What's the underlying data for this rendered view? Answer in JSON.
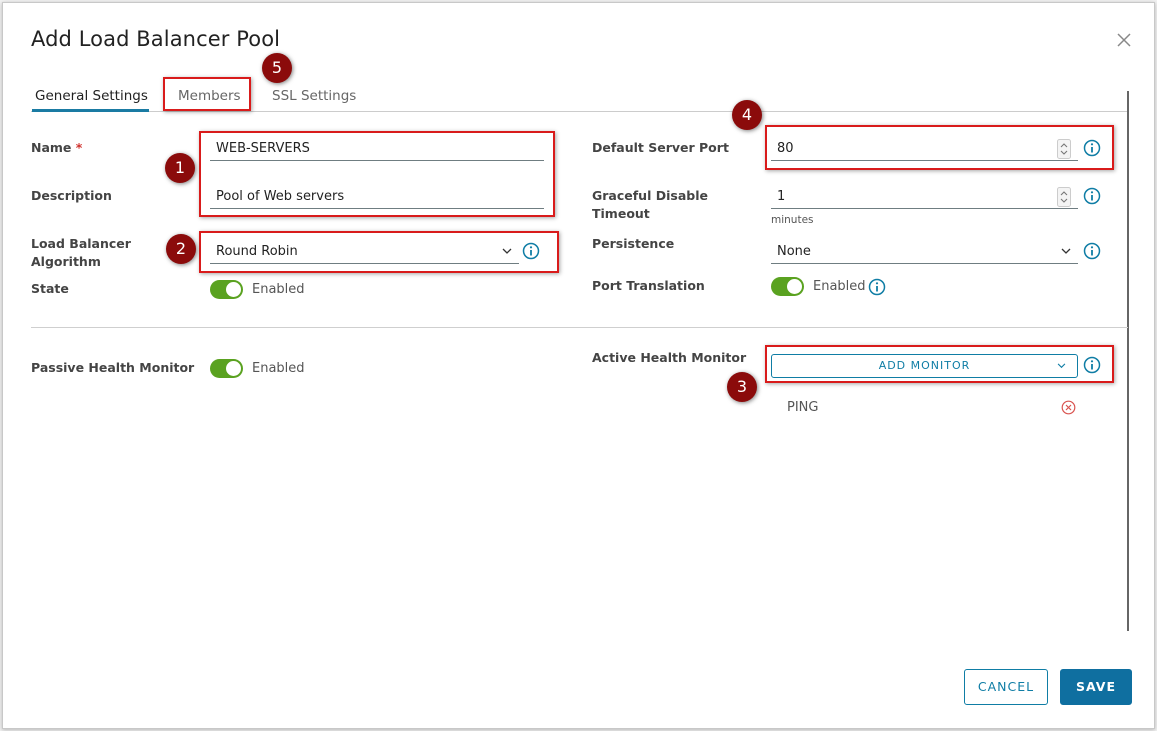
{
  "dialog": {
    "title": "Add Load Balancer Pool"
  },
  "tabs": [
    {
      "label": "General Settings",
      "active": true
    },
    {
      "label": "Members",
      "active": false
    },
    {
      "label": "SSL Settings",
      "active": false
    }
  ],
  "left": {
    "name_label": "Name",
    "required_mark": "*",
    "name_value": "WEB-SERVERS",
    "description_label": "Description",
    "description_value": "Pool of Web servers",
    "algorithm_label_1": "Load Balancer",
    "algorithm_label_2": "Algorithm",
    "algorithm_value": "Round Robin",
    "state_label": "State",
    "state_value": "Enabled",
    "passive_label": "Passive Health Monitor",
    "passive_value": "Enabled"
  },
  "right": {
    "port_label": "Default Server Port",
    "port_value": "80",
    "graceful_label_1": "Graceful Disable",
    "graceful_label_2": "Timeout",
    "graceful_value": "1",
    "graceful_unit": "minutes",
    "persistence_label": "Persistence",
    "persistence_value": "None",
    "port_translation_label": "Port Translation",
    "port_translation_value": "Enabled",
    "active_monitor_label": "Active Health Monitor",
    "add_monitor_label": "ADD MONITOR",
    "monitors": [
      "PING"
    ]
  },
  "markers": [
    "1",
    "2",
    "3",
    "4",
    "5"
  ],
  "footer": {
    "cancel_label": "CANCEL",
    "save_label": "SAVE"
  },
  "colors": {
    "accent": "#0f7da5",
    "toggle_on": "#5aa220",
    "annotation_red": "#d91b1b",
    "marker_fill": "#8b0b0b"
  },
  "icons": [
    "close-icon",
    "info-icon",
    "chevron-down-icon",
    "spinner-icon",
    "remove-circle-icon"
  ]
}
